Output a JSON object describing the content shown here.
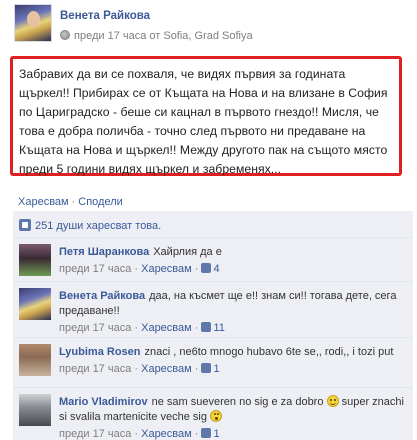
{
  "post": {
    "author": "Венета Райкова",
    "meta": "преди 17 часа от Sofia, Grad Sofiya",
    "text": "Забравих да ви се похваля, че видях първия за годината щъркел!! Прибирах се от Къщата на Нова и на влизане в София по Цариградско - беше си кацнал в първото гнездо!! Мисля, че това е добра поличба - точно след първото ни предаване на Къщата на Нова и щъркел!! Между другото пак на същото място преди 5 години видях щъркел и забременях..."
  },
  "actions": {
    "like": "Харесвам",
    "separator": "·",
    "share": "Сподели"
  },
  "likes": {
    "text": "251 души харесват това."
  },
  "comments": [
    {
      "author": "Петя Шаранкова",
      "text": "Хайрлия да е",
      "time": "преди 17 часа",
      "like": "Харесвам",
      "likes": "4"
    },
    {
      "author": "Венета Райкова",
      "text": "даа, на късмет ще е!! знам си!! тогава дете, сега предаване!!",
      "time": "преди 17 часа",
      "like": "Харесвам",
      "likes": "11"
    },
    {
      "author": "Lyubima Rosen",
      "text": "znaci , ne6to mnogo hubavo 6te se,, rodi,, i tozi put",
      "time": "преди 17 часа",
      "like": "Харесвам",
      "likes": "1"
    },
    {
      "author": "Mario Vladimirov",
      "text_a": "ne sam sueveren no sig e za dobro",
      "text_b": "super znachi si svalila martenicite veche sig",
      "time": "преди 17 часа",
      "like": "Харесвам",
      "likes": "1"
    }
  ],
  "colors": {
    "link": "#3b5998",
    "highlight": "#e02020",
    "feedback_bg": "#edeff4"
  }
}
